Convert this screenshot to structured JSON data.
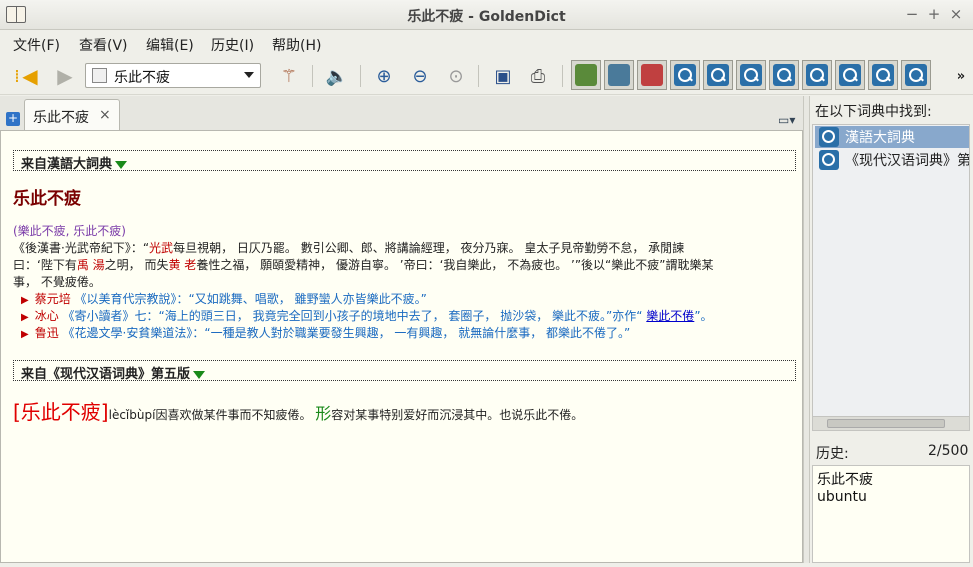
{
  "window": {
    "title": "乐此不疲 - GoldenDict",
    "minimize": "−",
    "maximize": "+",
    "close": "×"
  },
  "menu": [
    "文件(F)",
    "查看(V)",
    "编辑(E)",
    "历史(I)",
    "帮助(H)"
  ],
  "search": {
    "query": "乐此不疲"
  },
  "tab": {
    "label": "乐此不疲",
    "close": "×"
  },
  "article": {
    "dict1_header": "来自漢語大詞典",
    "headword": "乐此不疲",
    "variant": "(樂此不疲, 乐此不疲)",
    "def1_line1_a": "《後漢書·光武帝紀下》：“",
    "def1_name1": "光武",
    "def1_line1_b": "每旦視朝， 日仄乃罷。 數引公卿、郎、將講論經理， 夜分乃寐。 皇太子見帝勤勞不怠， 承閒諫",
    "def1_line2_a": "曰：‘陛下有",
    "def1_name2": "禹 湯",
    "def1_line2_b": "之明， 而失",
    "def1_name3": "黄 老",
    "def1_line2_c": "養性之福， 願頤愛精神， 優游自寧。 ’帝曰：‘我自樂此， 不為疲也。 ’”後以“樂此不疲”謂耽樂某",
    "def1_line3": "事， 不覺疲倦。",
    "ex1_author": "蔡元培",
    "ex1_text": "《以美育代宗教說》：“又如跳舞、唱歌， 雖野蠻人亦皆樂此不疲。”",
    "ex2_author": "冰心",
    "ex2_text": "《寄小讀者》七：“海上的頭三日， 我竟完全回到小孩子的境地中去了， 套圈子， 抛沙袋， 樂此不疲。”亦作“",
    "ex2_link": "樂此不倦",
    "ex2_end": "”。",
    "ex3_author": "鲁迅",
    "ex3_text": "《花邊文學·安貧樂道法》：“一種是教人對於職業要發生興趣， 一有興趣， 就無論什麼事， 都樂此不倦了。”",
    "dict2_header": "来自《现代汉语词典》第五版",
    "dict2_word": "[乐此不疲]",
    "dict2_pinyin": "lècǐbùpí",
    "dict2_def1": "因喜欢做某件事而不知疲倦。",
    "dict2_pos": "形",
    "dict2_def2": "容对某事特别爱好而沉浸其中。也说乐此不倦。"
  },
  "found": {
    "title": "在以下词典中找到:",
    "items": [
      "漢語大詞典",
      "《现代汉语词典》第"
    ]
  },
  "history": {
    "title": "历史:",
    "count": "2/500",
    "items": [
      "乐此不疲",
      "ubuntu"
    ]
  }
}
